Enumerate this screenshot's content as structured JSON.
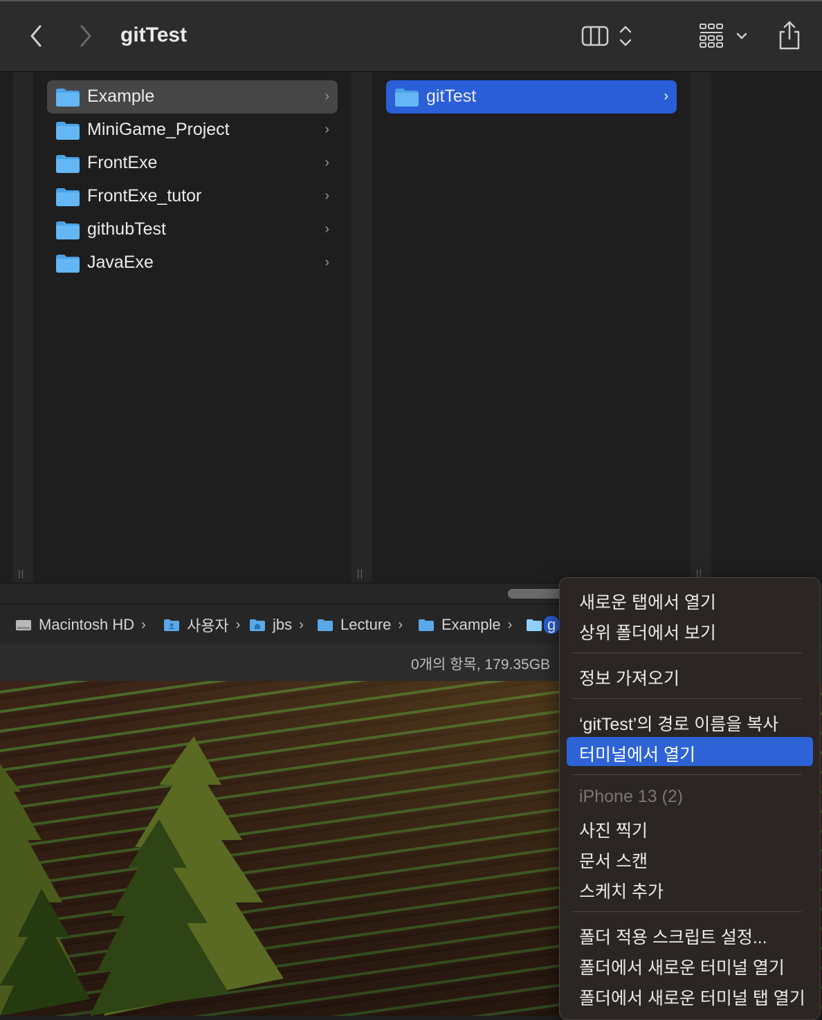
{
  "window": {
    "title": "gitTest"
  },
  "toolbar": {
    "back_icon": "chevron-left-icon",
    "forward_icon": "chevron-right-icon",
    "view_icon": "column-view-icon",
    "group_icon": "grid-group-icon",
    "share_icon": "share-icon"
  },
  "column1": {
    "items": [
      {
        "label": "Example",
        "selected": true
      },
      {
        "label": "MiniGame_Project"
      },
      {
        "label": "FrontExe"
      },
      {
        "label": "FrontExe_tutor"
      },
      {
        "label": "githubTest"
      },
      {
        "label": "JavaExe"
      }
    ]
  },
  "column2": {
    "items": [
      {
        "label": "gitTest",
        "selected": true
      }
    ]
  },
  "pathbar": {
    "crumbs": [
      {
        "label": "Macintosh HD",
        "icon": "hard-drive-icon"
      },
      {
        "label": "사용자",
        "icon": "users-folder-icon"
      },
      {
        "label": "jbs",
        "icon": "home-folder-icon"
      },
      {
        "label": "Lecture",
        "icon": "folder-icon"
      },
      {
        "label": "Example",
        "icon": "folder-icon"
      },
      {
        "label": "g",
        "icon": "folder-icon"
      }
    ]
  },
  "status": {
    "text": "0개의 항목, 179.35GB"
  },
  "context_menu": {
    "items": [
      {
        "label": "새로운 탭에서 열기"
      },
      {
        "label": "상위 폴더에서 보기"
      },
      {
        "label": "정보 가져오기"
      },
      {
        "label": "‘gitTest’의 경로 이름을 복사"
      },
      {
        "label": "터미널에서 열기",
        "highlighted": true
      },
      {
        "label": "iPhone 13 (2)",
        "disabled": true
      },
      {
        "label": "사진 찍기"
      },
      {
        "label": "문서 스캔"
      },
      {
        "label": "스케치 추가"
      },
      {
        "label": "폴더 적용 스크립트 설정..."
      },
      {
        "label": "폴더에서 새로운 터미널 열기"
      },
      {
        "label": "폴더에서 새로운 터미널 탭 열기"
      }
    ]
  },
  "colors": {
    "selection_blue": "#2a5fd8",
    "menu_highlight": "#2d63d6",
    "folder_blue": "#5ab0f0"
  }
}
